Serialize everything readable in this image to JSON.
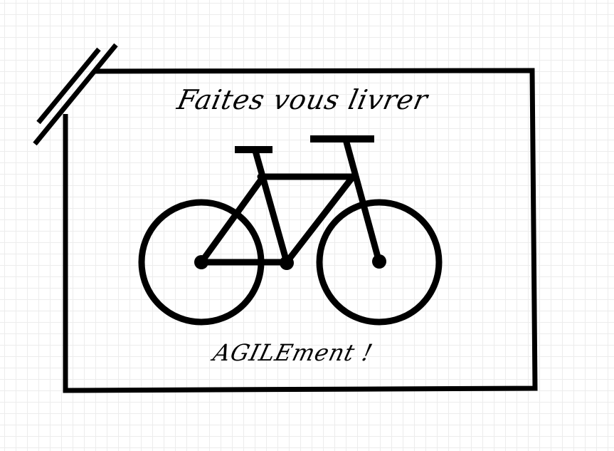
{
  "card": {
    "headline": "Faites vous livrer",
    "tagline": "AGILEment !"
  },
  "illustration": {
    "icon": "bicycle-icon",
    "stroke_color": "#000000",
    "background_color": "#ffffff",
    "grid_color": "#ececec"
  }
}
